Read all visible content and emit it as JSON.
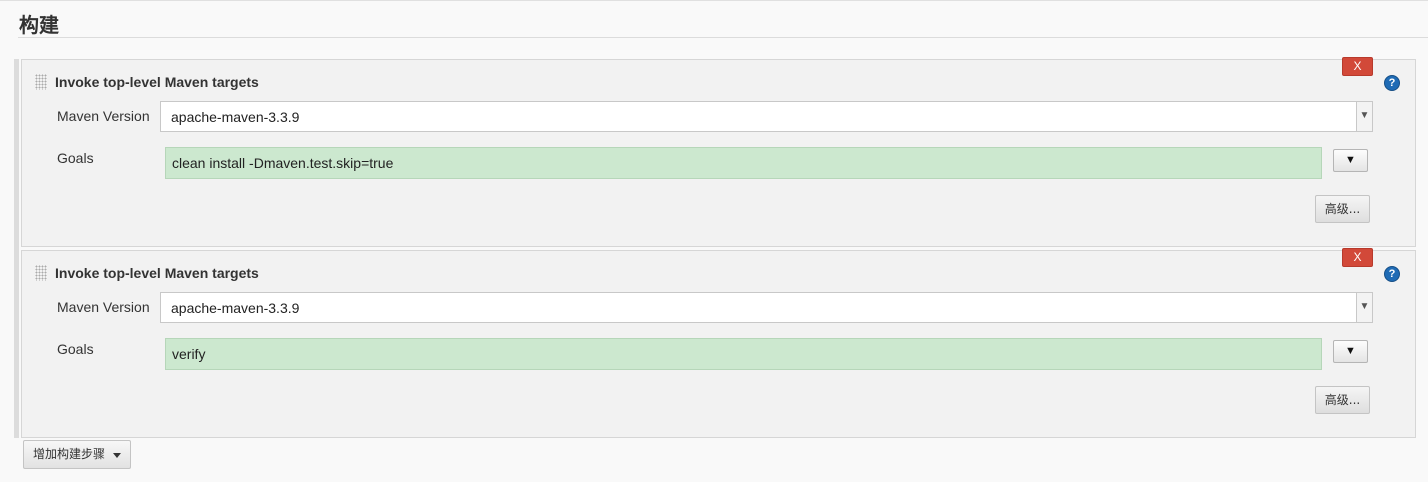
{
  "section": {
    "title": "构建"
  },
  "steps": [
    {
      "title": "Invoke top-level Maven targets",
      "delete_label": "X",
      "help_glyph": "?",
      "maven_version_label": "Maven Version",
      "maven_version_value": "apache-maven-3.3.9",
      "goals_label": "Goals",
      "goals_value": "clean install -Dmaven.test.skip=true",
      "expand_glyph": "▼",
      "advanced_label": "高级..."
    },
    {
      "title": "Invoke top-level Maven targets",
      "delete_label": "X",
      "help_glyph": "?",
      "maven_version_label": "Maven Version",
      "maven_version_value": "apache-maven-3.3.9",
      "goals_label": "Goals",
      "goals_value": "verify",
      "expand_glyph": "▼",
      "advanced_label": "高级..."
    }
  ],
  "add_step": {
    "label": "增加构建步骤"
  },
  "icons": {
    "drag_handle": "drag-handle-icon",
    "help": "help-icon",
    "select_arrow": "chevron-down-icon",
    "dropdown_caret": "caret-down-icon"
  },
  "colors": {
    "delete_button": "#d24939",
    "goals_field_bg": "#cce8cf",
    "help_icon": "#1f6bb5"
  }
}
